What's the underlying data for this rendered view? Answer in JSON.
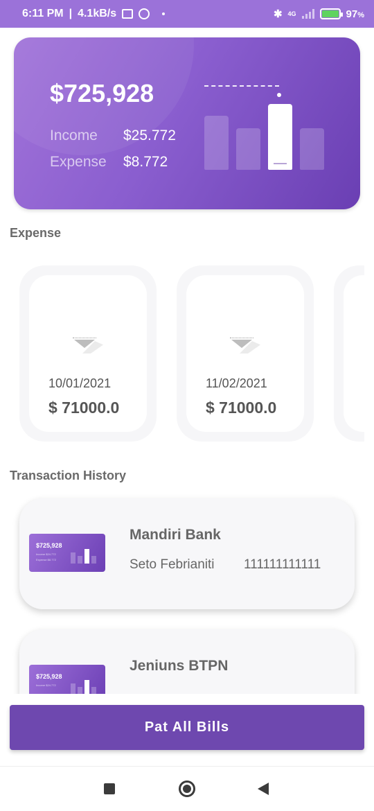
{
  "status_bar": {
    "time": "6:11 PM",
    "net_speed": "4.1kB/s",
    "battery": "97",
    "network": "4G"
  },
  "hero": {
    "amount": "$725,928",
    "income_label": "Income",
    "income_value": "$25.772",
    "expense_label": "Expense",
    "expense_value": "$8.772"
  },
  "expense_section": {
    "title": "Expense",
    "cards": [
      {
        "date": "10/01/2021",
        "amount": "$ 71000.0"
      },
      {
        "date": "11/02/2021",
        "amount": "$ 71000.0"
      }
    ]
  },
  "transactions": {
    "title": "Transaction History",
    "items": [
      {
        "bank": "Mandiri Bank",
        "name": "Seto Febrianiti",
        "number": "111111111111",
        "thumb_amount": "$725,928",
        "thumb_income": "Income   $24.772",
        "thumb_expense": "Expense  $8.772"
      },
      {
        "bank": "Jeniuns BTPN",
        "thumb_amount": "$725,928",
        "thumb_income": "Income   $24.772"
      }
    ]
  },
  "pay_button": "Pat All Bills"
}
